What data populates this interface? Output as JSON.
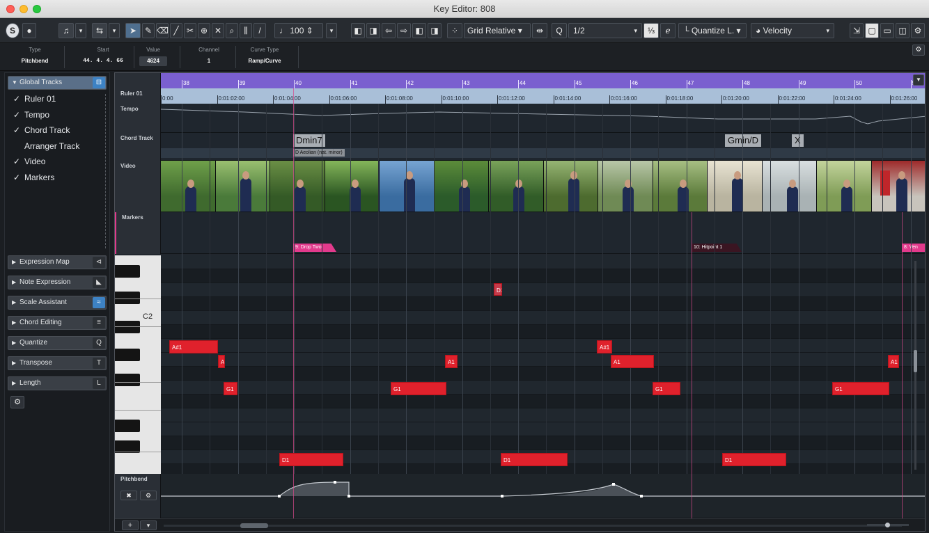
{
  "window": {
    "title": "Key Editor: 808"
  },
  "toolbar": {
    "solo_label": "S",
    "quantize_mode": "Grid Relative",
    "quantize_value": "1/2",
    "quantize_preset": "Quantize L.",
    "velocity_value": "100",
    "controller_lane": "Velocity",
    "close_glyph": "✕",
    "zoom_glyph": "⌕",
    "magic_q_label": "Q"
  },
  "info": {
    "type_label": "Type",
    "type_value": "Pitchbend",
    "start_label": "Start",
    "start_value": "44. 4. 4. 66",
    "value_label": "Value",
    "value_value": "4624",
    "channel_label": "Channel",
    "channel_value": "1",
    "curve_label": "Curve Type",
    "curve_value": "Ramp/Curve"
  },
  "left": {
    "global_tracks": "Global Tracks",
    "tracks": [
      {
        "label": "Ruler 01",
        "checked": "✓"
      },
      {
        "label": "Tempo",
        "checked": "✓"
      },
      {
        "label": "Chord Track",
        "checked": "✓"
      },
      {
        "label": "Arranger Track",
        "checked": ""
      },
      {
        "label": "Video",
        "checked": "✓"
      },
      {
        "label": "Markers",
        "checked": "✓"
      }
    ],
    "sections": [
      {
        "label": "Expression Map",
        "icon": "⊲"
      },
      {
        "label": "Note Expression",
        "icon": "◣"
      },
      {
        "label": "Scale Assistant",
        "icon": "≈"
      },
      {
        "label": "Chord Editing",
        "icon": "≡"
      },
      {
        "label": "Quantize",
        "icon": "Q"
      },
      {
        "label": "Transpose",
        "icon": "T"
      },
      {
        "label": "Length",
        "icon": "L"
      }
    ]
  },
  "ruler": {
    "bars": [
      "38",
      "39",
      "40",
      "41",
      "42",
      "43",
      "44",
      "45",
      "46",
      "47",
      "48",
      "49",
      "50",
      "51"
    ],
    "times": [
      "0:00",
      "0:01:02:00",
      "0:01:04:00",
      "0:01:06:00",
      "0:01:08:00",
      "0:01:10:00",
      "0:01:12:00",
      "0:01:14:00",
      "0:01:16:00",
      "0:01:18:00",
      "0:01:20:00",
      "0:01:22:00",
      "0:01:24:00",
      "0:01:26:00"
    ]
  },
  "track_names": {
    "ruler": "Ruler 01",
    "tempo": "Tempo",
    "chord": "Chord Track",
    "video": "Video",
    "markers": "Markers",
    "pitchbend": "Pitchbend"
  },
  "chords": {
    "c1": "Dmin7",
    "c1_scale": "D Aeolian (nat. minor)",
    "c2": "Gmin/D",
    "c3": "X"
  },
  "markers": {
    "m1": "9: Drop Two",
    "m2": "10: Hitpoint 1",
    "m3": "8: Ven"
  },
  "piano": {
    "c2_label": "C2"
  },
  "notes": [
    "D2",
    "A#1",
    "A",
    "G1",
    "G1",
    "A1",
    "A#1",
    "A1",
    "G1",
    "G1",
    "A1",
    "D1",
    "D1",
    "D1"
  ],
  "pitchbend_tools": {
    "a": "✖",
    "b": "⚙"
  },
  "footer": {
    "add": "+",
    "menu": "▾"
  }
}
